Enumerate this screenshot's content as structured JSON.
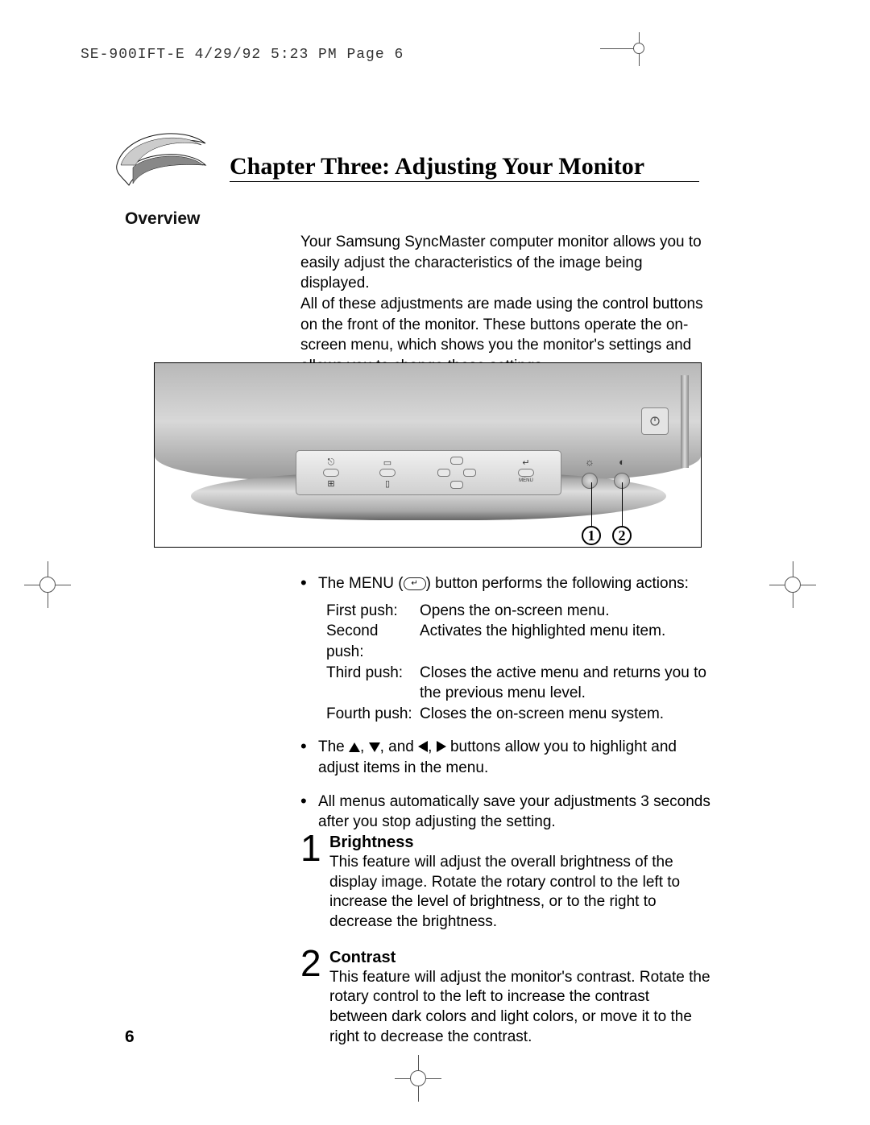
{
  "header": {
    "slug_line": "SE-900IFT-E  4/29/92 5:23 PM  Page 6"
  },
  "chapter_title": "Chapter Three: Adjusting Your Monitor",
  "section_label": "Overview",
  "overview_paragraph_1": "Your Samsung SyncMaster computer monitor allows you to easily adjust the characteristics of the image being displayed.",
  "overview_paragraph_2": "All of these adjustments are made using the control buttons on the front of the monitor. These buttons operate the on-screen menu, which shows you the monitor's settings and allows you to change those settings.",
  "figure": {
    "callout_1": "1",
    "callout_2": "2",
    "panel_menu_label": "MENU"
  },
  "bullets": {
    "menu_intro_pre": "The MENU (",
    "menu_intro_post": ") button performs the following actions:",
    "pushes": [
      {
        "label": "First push:",
        "value": "Opens the on-screen menu."
      },
      {
        "label": "Second push:",
        "value": "Activates the highlighted menu item."
      },
      {
        "label": "Third push:",
        "value": "Closes the active menu and returns you to the previous menu level."
      },
      {
        "label": "Fourth push:",
        "value": "Closes the on-screen menu system."
      }
    ],
    "arrows_pre": "The ",
    "arrows_mid1": ", ",
    "arrows_mid2": ", and ",
    "arrows_mid3": ", ",
    "arrows_post": " buttons allow you to highlight and adjust items in the menu.",
    "auto_save": "All menus automatically save your adjustments 3 seconds after you stop adjusting the setting."
  },
  "items": [
    {
      "num": "1",
      "title": "Brightness",
      "body": "This feature will adjust the overall brightness of the display image. Rotate the rotary control to the left to increase the level of brightness, or to the right to decrease the brightness."
    },
    {
      "num": "2",
      "title": "Contrast",
      "body": "This feature will adjust the monitor's contrast. Rotate the rotary control to the left to increase the contrast between dark colors and light colors, or move it to the right to decrease the contrast."
    }
  ],
  "page_number": "6"
}
